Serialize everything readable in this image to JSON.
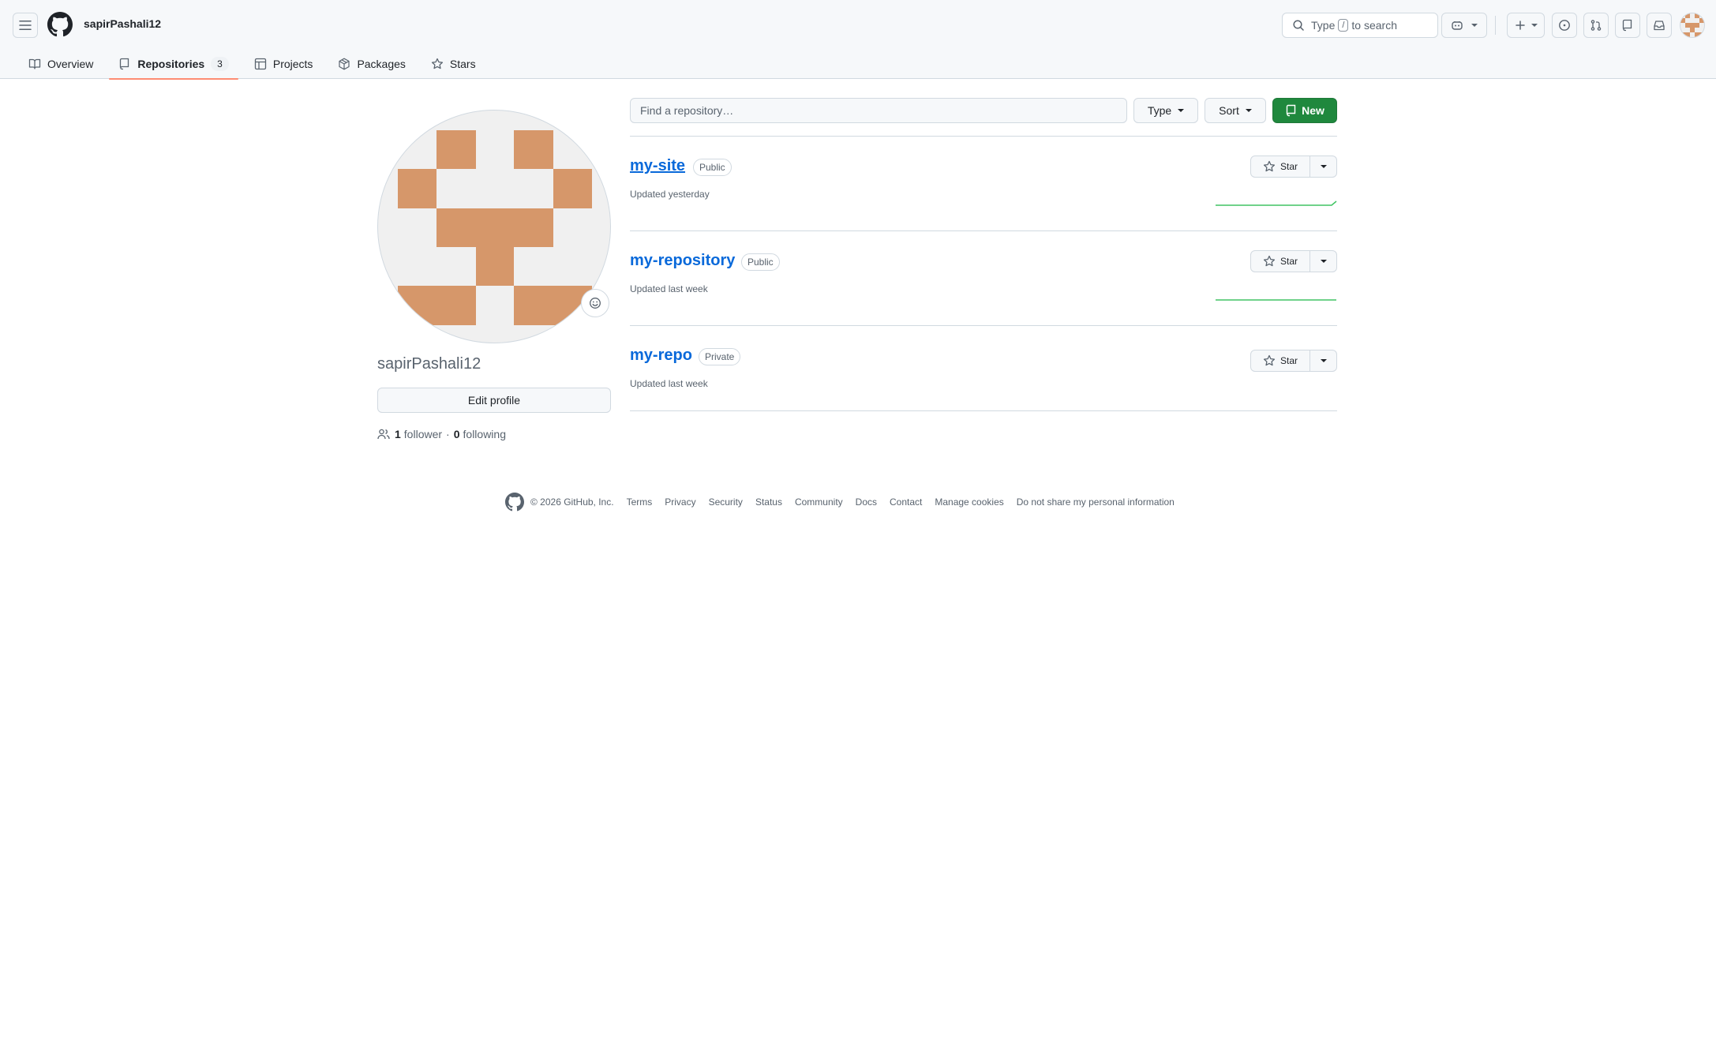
{
  "header": {
    "username": "sapirPashali12",
    "search_prefix": "Type",
    "search_key": "/",
    "search_suffix": "to search"
  },
  "tabs": [
    {
      "label": "Overview",
      "icon": "book-icon"
    },
    {
      "label": "Repositories",
      "icon": "repo-icon",
      "count": "3"
    },
    {
      "label": "Projects",
      "icon": "table-icon"
    },
    {
      "label": "Packages",
      "icon": "package-icon"
    },
    {
      "label": "Stars",
      "icon": "star-icon"
    }
  ],
  "profile": {
    "name": "sapirPashali12",
    "edit_label": "Edit profile",
    "followers_count": "1",
    "followers_label": "follower",
    "separator": "·",
    "following_count": "0",
    "following_label": "following"
  },
  "filters": {
    "find_placeholder": "Find a repository…",
    "type_label": "Type",
    "sort_label": "Sort",
    "new_label": "New"
  },
  "repos": [
    {
      "name": "my-site",
      "visibility": "Public",
      "updated": "Updated yesterday",
      "star_label": "Star"
    },
    {
      "name": "my-repository",
      "visibility": "Public",
      "updated": "Updated last week",
      "star_label": "Star"
    },
    {
      "name": "my-repo",
      "visibility": "Private",
      "updated": "Updated last week",
      "star_label": "Star"
    }
  ],
  "footer": {
    "copyright": "© 2026 GitHub, Inc.",
    "links": [
      "Terms",
      "Privacy",
      "Security",
      "Status",
      "Community",
      "Docs",
      "Contact",
      "Manage cookies",
      "Do not share my personal information"
    ]
  },
  "colors": {
    "accent_green": "#1f883d",
    "link_blue": "#0969da",
    "tab_underline": "#fd8c73",
    "avatar_identicon": "#d6976a"
  }
}
